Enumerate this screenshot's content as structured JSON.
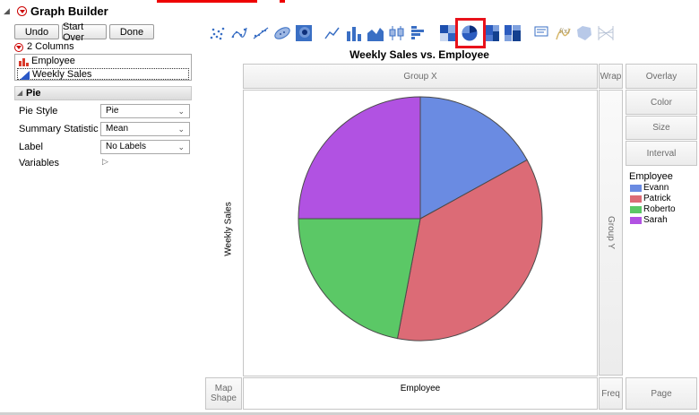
{
  "window": {
    "title": "Graph Builder"
  },
  "buttons": {
    "undo": "Undo",
    "start_over": "Start Over",
    "done": "Done"
  },
  "columns": {
    "header": "2 Columns",
    "items": [
      {
        "label": "Employee",
        "icon": "nominal-bar-icon"
      },
      {
        "label": "Weekly Sales",
        "icon": "continuous-triangle-icon"
      }
    ]
  },
  "pie_section": {
    "title": "Pie",
    "options": [
      {
        "label": "Pie Style",
        "value": "Pie"
      },
      {
        "label": "Summary Statistic",
        "value": "Mean"
      },
      {
        "label": "Label",
        "value": "No Labels"
      }
    ],
    "variables_label": "Variables"
  },
  "toolbar": {
    "icons": [
      "points-icon",
      "smoother-icon",
      "line-of-fit-icon",
      "ellipse-icon",
      "contour-icon",
      "line-icon",
      "bar-icon",
      "area-icon",
      "box-plot-icon",
      "histogram-icon",
      "heatmap-icon",
      "pie-icon",
      "treemap-icon",
      "mosaic-icon",
      "caption-box-icon",
      "formula-icon",
      "map-shapes-icon",
      "parallel-plot-icon"
    ],
    "selected": "pie-icon",
    "highlight_color": "#e8121b"
  },
  "graph": {
    "title": "Weekly Sales vs. Employee",
    "y_label": "Weekly Sales",
    "x_label": "Employee"
  },
  "zones": {
    "group_x": "Group X",
    "group_y": "Group Y",
    "wrap": "Wrap",
    "freq": "Freq",
    "map_shape": "Map Shape",
    "overlay": "Overlay",
    "color": "Color",
    "size": "Size",
    "interval": "Interval",
    "page": "Page"
  },
  "legend": {
    "title": "Employee",
    "items": [
      {
        "label": "Evann",
        "color": "#6a8be2"
      },
      {
        "label": "Patrick",
        "color": "#dc6b76"
      },
      {
        "label": "Roberto",
        "color": "#5bc866"
      },
      {
        "label": "Sarah",
        "color": "#b152e2"
      }
    ]
  },
  "chart_data": {
    "type": "pie",
    "categories": [
      "Evann",
      "Patrick",
      "Roberto",
      "Sarah"
    ],
    "values": [
      17,
      36,
      22,
      25
    ],
    "colors": [
      "#6a8be2",
      "#dc6b76",
      "#5bc866",
      "#b152e2"
    ],
    "title": "Weekly Sales vs. Employee",
    "xlabel": "Employee",
    "ylabel": "Weekly Sales"
  }
}
